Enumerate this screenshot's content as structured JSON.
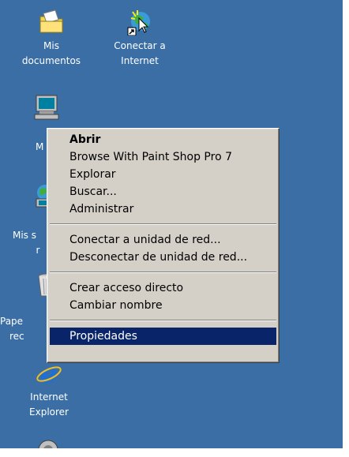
{
  "desktop": {
    "background": "#3a6ea5",
    "icons": [
      {
        "label_line1": "Mis",
        "label_line2": "documentos",
        "icon": "folder-documents-icon"
      },
      {
        "label_line1": "Conectar a",
        "label_line2": "Internet",
        "icon": "connect-internet-icon"
      },
      {
        "label_line1": "M",
        "icon": "my-computer-icon"
      },
      {
        "label_line1": "Mis s",
        "label_line2": "r",
        "icon": "network-places-icon"
      },
      {
        "label_line1": "Pape",
        "label_line2": "rec",
        "icon": "recycle-bin-icon"
      },
      {
        "label_line1": "Internet",
        "label_line2": "Explorer",
        "icon": "internet-explorer-icon"
      }
    ]
  },
  "context_menu": {
    "items": {
      "open": "Abrir",
      "paint_shop": "Browse With Paint Shop Pro 7",
      "explore": "Explorar",
      "search": "Buscar...",
      "manage": "Administrar",
      "map_drive": "Conectar a unidad de red...",
      "disconnect_drive": "Desconectar de unidad de red...",
      "create_shortcut": "Crear acceso directo",
      "rename": "Cambiar nombre",
      "properties": "Propiedades"
    },
    "selected_item": "properties",
    "selection_color": "#0a246a"
  }
}
